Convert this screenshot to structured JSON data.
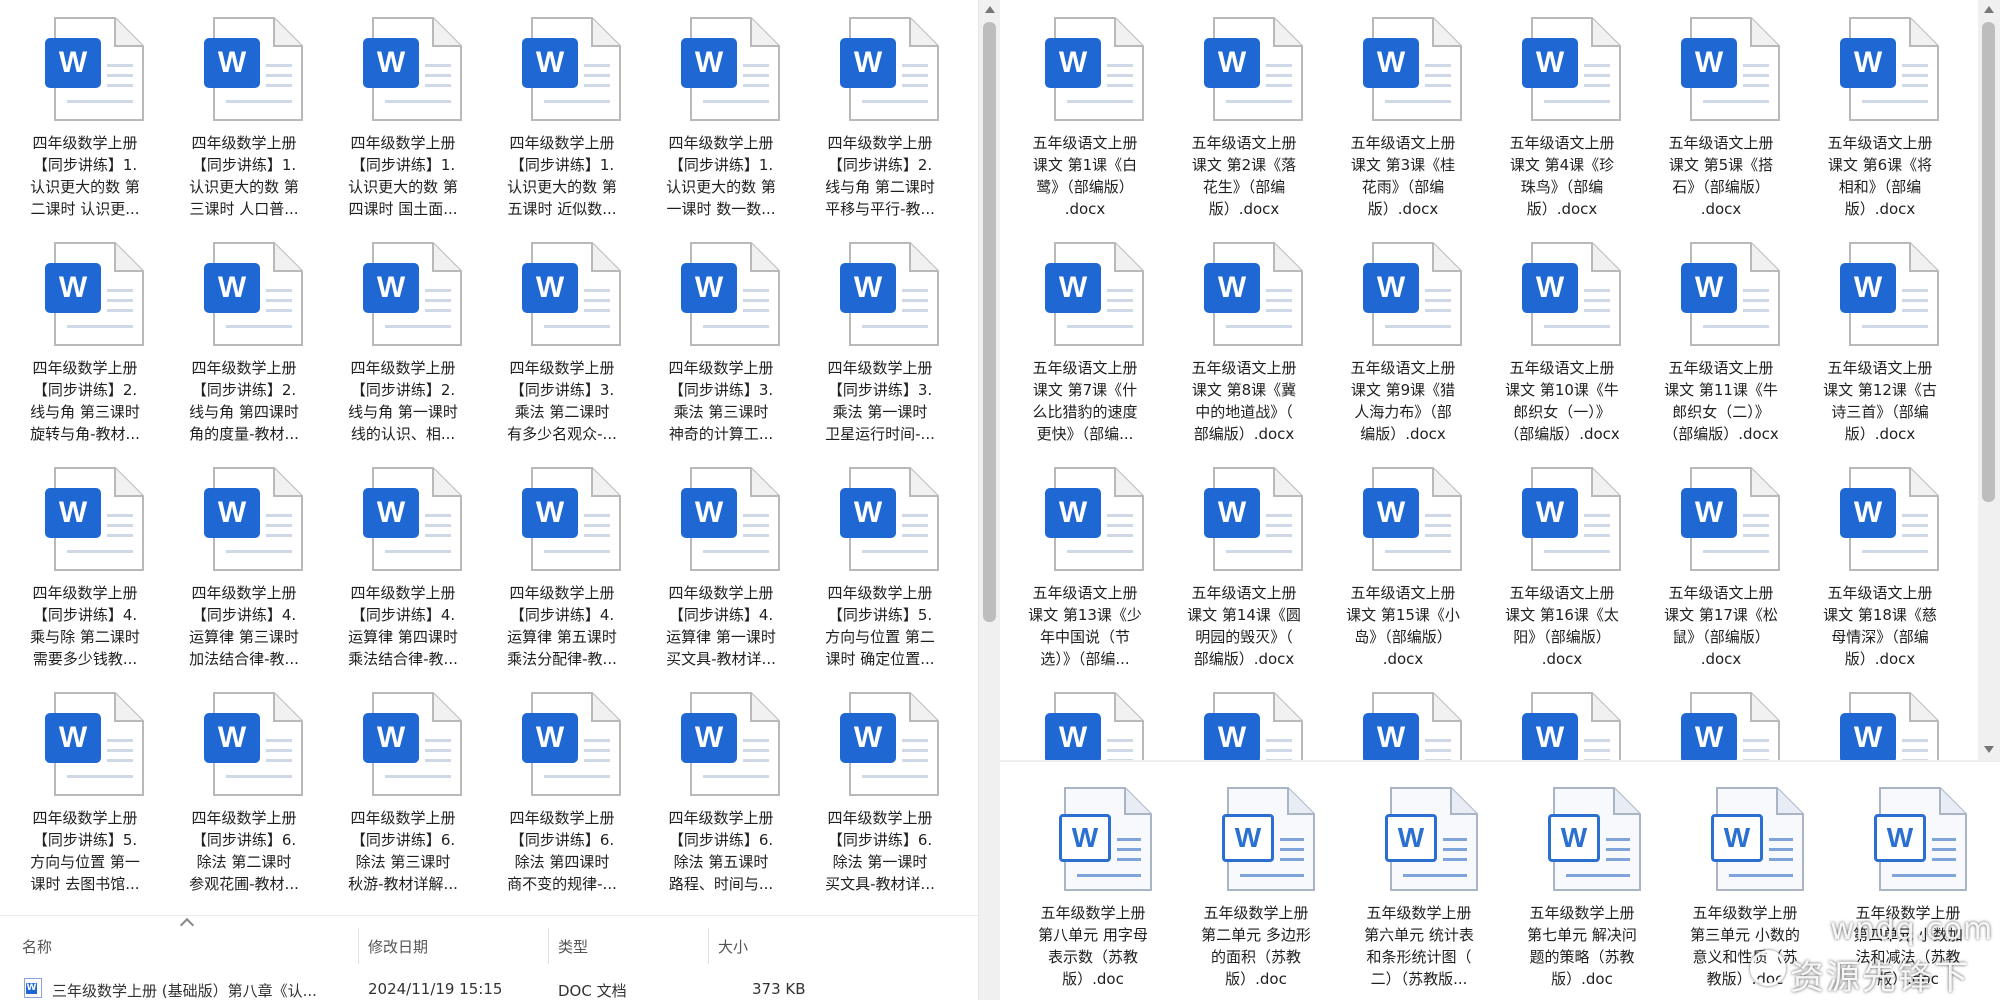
{
  "left_pane": {
    "files": [
      "四年级数学上册\n【同步讲练】1.\n认识更大的数 第\n二课时  认识更...",
      "四年级数学上册\n【同步讲练】1.\n认识更大的数 第\n三课时  人口普...",
      "四年级数学上册\n【同步讲练】1.\n认识更大的数 第\n四课时  国土面...",
      "四年级数学上册\n【同步讲练】1.\n认识更大的数 第\n五课时  近似数...",
      "四年级数学上册\n【同步讲练】1.\n认识更大的数 第\n一课时  数一数...",
      "四年级数学上册\n【同步讲练】2.\n线与角 第二课时\n平移与平行-教...",
      "四年级数学上册\n【同步讲练】2.\n线与角 第三课时\n旋转与角-教材...",
      "四年级数学上册\n【同步讲练】2.\n线与角 第四课时\n角的度量-教材...",
      "四年级数学上册\n【同步讲练】2.\n线与角 第一课时\n线的认识、相...",
      "四年级数学上册\n【同步讲练】3.\n乘法 第二课时\n有多少名观众-...",
      "四年级数学上册\n【同步讲练】3.\n乘法 第三课时\n神奇的计算工...",
      "四年级数学上册\n【同步讲练】3.\n乘法 第一课时\n卫星运行时间-...",
      "四年级数学上册\n【同步讲练】4.\n乘与除 第二课时\n需要多少钱教...",
      "四年级数学上册\n【同步讲练】4.\n运算律 第三课时\n加法结合律-教...",
      "四年级数学上册\n【同步讲练】4.\n运算律 第四课时\n乘法结合律-教...",
      "四年级数学上册\n【同步讲练】4.\n运算律 第五课时\n乘法分配律-教...",
      "四年级数学上册\n【同步讲练】4.\n运算律 第一课时\n买文具-教材详...",
      "四年级数学上册\n【同步讲练】5.\n方向与位置 第二\n课时  确定位置...",
      "四年级数学上册\n【同步讲练】5.\n方向与位置 第一\n课时  去图书馆...",
      "四年级数学上册\n【同步讲练】6.\n除法 第二课时\n参观花圃-教材...",
      "四年级数学上册\n【同步讲练】6.\n除法 第三课时\n秋游-教材详解...",
      "四年级数学上册\n【同步讲练】6.\n除法 第四课时\n商不变的规律-...",
      "四年级数学上册\n【同步讲练】6.\n除法 第五课时\n路程、时间与...",
      "四年级数学上册\n【同步讲练】6.\n除法 第一课时\n买文具-教材详..."
    ],
    "icon_letter": "W"
  },
  "details_view": {
    "headers": {
      "name": "名称",
      "modified": "修改日期",
      "type": "类型",
      "size": "大小"
    },
    "row": {
      "name": "三年级数学上册    (基础版）第八章《认...",
      "modified": "2024/11/19 15:15",
      "type": "DOC 文档",
      "size": "373 KB"
    }
  },
  "right_pane": {
    "files": [
      "五年级语文上册\n课文 第1课《白\n鹭》（部编版）\n.docx",
      "五年级语文上册\n课文 第2课《落\n花生》（部编\n版）.docx",
      "五年级语文上册\n课文 第3课《桂\n花雨》（部编\n版）.docx",
      "五年级语文上册\n课文 第4课《珍\n珠鸟》（部编\n版）.docx",
      "五年级语文上册\n课文 第5课《搭\n石》（部编版）\n.docx",
      "五年级语文上册\n课文 第6课《将\n相和》（部编\n版）.docx",
      "五年级语文上册\n课文 第7课《什\n么比猎豹的速度\n更快》（部编...",
      "五年级语文上册\n课文 第8课《冀\n中的地道战》（\n部编版）.docx",
      "五年级语文上册\n课文 第9课《猎\n人海力布》（部\n编版）.docx",
      "五年级语文上册\n课文 第10课《牛\n郎织女（一）》\n（部编版）.docx",
      "五年级语文上册\n课文 第11课《牛\n郎织女（二）》\n（部编版）.docx",
      "五年级语文上册\n课文 第12课《古\n诗三首》（部编\n版）.docx",
      "五年级语文上册\n课文 第13课《少\n年中国说（节\n选）》（部编...",
      "五年级语文上册\n课文 第14课《圆\n明园的毁灭》（\n部编版）.docx",
      "五年级语文上册\n课文 第15课《小\n岛》（部编版）\n.docx",
      "五年级语文上册\n课文 第16课《太\n阳》（部编版）\n.docx",
      "五年级语文上册\n课文 第17课《松\n鼠》（部编版）\n.docx",
      "五年级语文上册\n课文 第18课《慈\n母情深》（部编\n版）.docx"
    ],
    "bottom_files": [
      "五年级数学上册\n第八单元  用字母\n表示数（苏教\n版）.doc",
      "五年级数学上册\n第二单元  多边形\n的面积（苏教\n版）.doc",
      "五年级数学上册\n第六单元  统计表\n和条形统计图（\n二）（苏教版...",
      "五年级数学上册\n第七单元  解决问\n题的策略（苏教\n版）.doc",
      "五年级数学上册\n第三单元  小数的\n意义和性质（苏\n教版）.doc",
      "五年级数学上册\n第四单元  小数加\n法和减法（苏教\n版）.doc"
    ],
    "icon_letter": "W"
  },
  "watermark": {
    "url": "wndq.com",
    "name": "资源先锋下载"
  },
  "colors": {
    "word_blue": "#1f68d3",
    "background": "#ffffff",
    "scrollbar": "#f0f0f0"
  }
}
